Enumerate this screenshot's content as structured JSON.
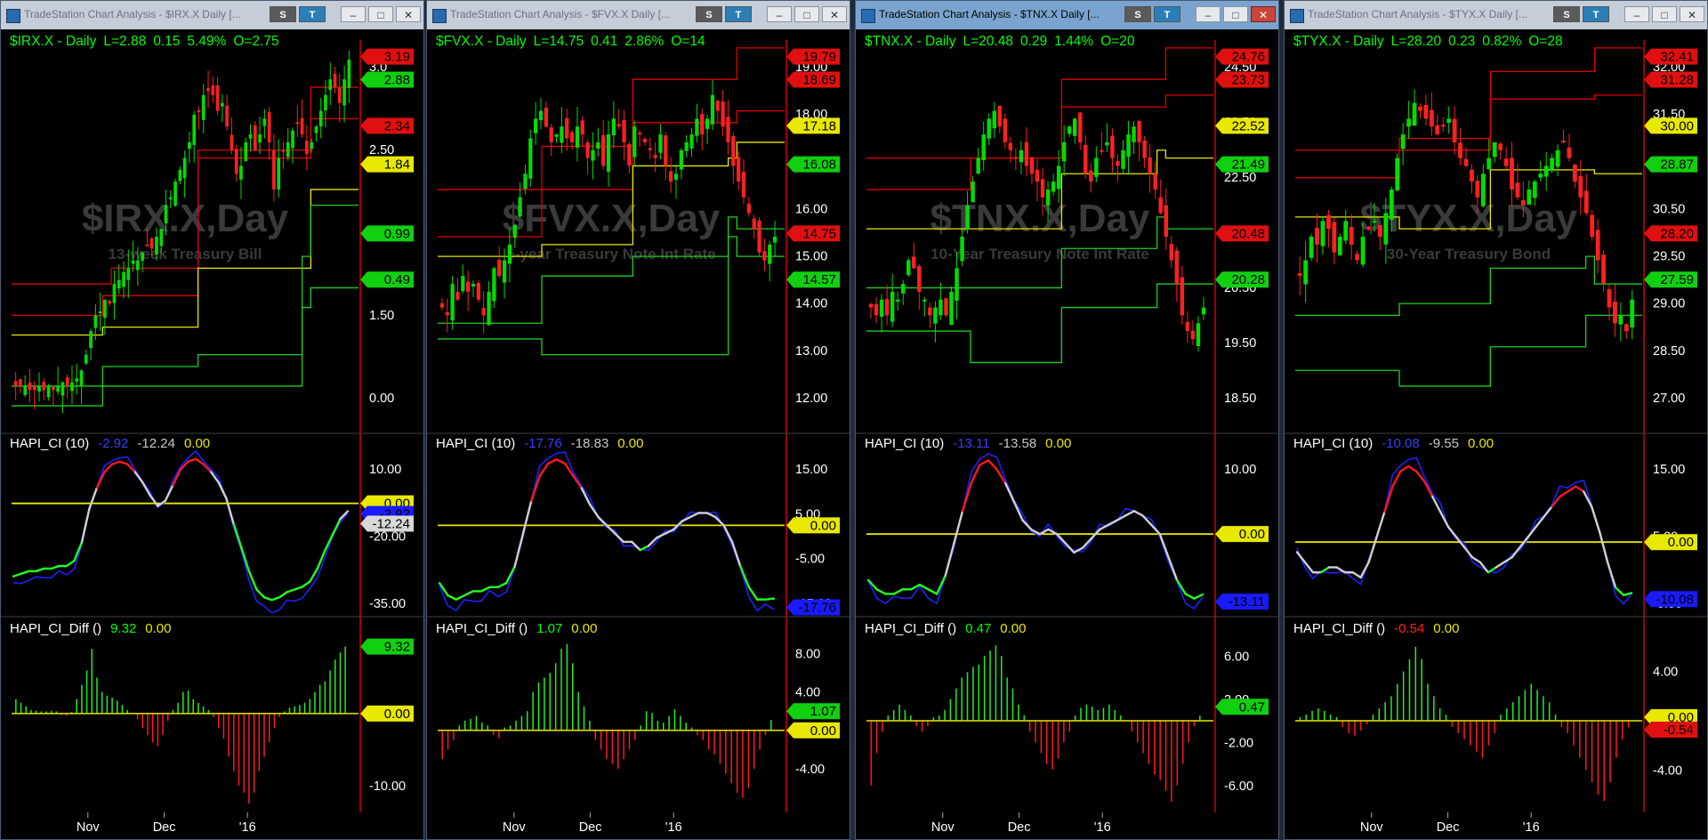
{
  "common": {
    "months": [
      "Nov",
      "Dec",
      "'16"
    ],
    "ci_title": "HAPI_CI (10)",
    "diff_title": "HAPI_CI_Diff ()",
    "btn_s": "S",
    "btn_t": "T",
    "minimize_label": "–",
    "maximize_label": "□",
    "close_label": "✕"
  },
  "colors": {
    "up_candle": "#00dd00",
    "down_candle": "#ff2020",
    "red_line": "#e00000",
    "green_line": "#1ed01e",
    "yellow_line": "#e8e800",
    "ci_blue": "#2020ff",
    "tag_red": "#e01010",
    "tag_green": "#10d010",
    "tag_yellow": "#e8e800",
    "tag_blue": "#1a1aff",
    "tag_gray": "#d8d8d8",
    "axis_red": "#d00000",
    "watermark": "#3a3a3a",
    "title_green": "#00ff00"
  },
  "windows": [
    {
      "window_title": "TradeStation Chart Analysis - $IRX.X Daily [...",
      "active": false,
      "price_header": {
        "symbol": "$IRX.X - Daily",
        "last": "L=2.88",
        "change": "0.15",
        "pct": "5.49%",
        "open": "O=2.75"
      },
      "watermark": "$IRX.X,Day",
      "watermark_sub": "13-week Treasury Bill",
      "price_axis": [
        "3.0",
        "2.50",
        "2.00",
        "1.50",
        "0.00"
      ],
      "price_tags": [
        {
          "value": "3.19",
          "color": "red"
        },
        {
          "value": "2.88",
          "color": "green"
        },
        {
          "value": "2.34",
          "color": "red"
        },
        {
          "value": "1.84",
          "color": "yellow"
        },
        {
          "value": "0.99",
          "color": "green"
        },
        {
          "value": "0.49",
          "color": "green"
        }
      ],
      "ci_values": {
        "v1": "-2.92",
        "v2": "-12.24",
        "v3": "0.00"
      },
      "ci_axis": [
        "10.00",
        "-20.00",
        "-35.00"
      ],
      "ci_tags": [
        {
          "value": "0.00",
          "color": "yellow"
        },
        {
          "value": "-2.92",
          "color": "blue"
        },
        {
          "value": "-12.24",
          "color": "gray"
        }
      ],
      "diff_values": {
        "v1": "9.32",
        "v2": "0.00"
      },
      "diff_axis": [
        "-10.00"
      ],
      "diff_tags": [
        {
          "value": "9.32",
          "color": "green"
        },
        {
          "value": "0.00",
          "color": "yellow"
        }
      ]
    },
    {
      "window_title": "TradeStation Chart Analysis - $FVX.X Daily [...",
      "active": false,
      "price_header": {
        "symbol": "$FVX.X - Daily",
        "last": "L=14.75",
        "change": "0.41",
        "pct": "2.86%",
        "open": "O=14"
      },
      "watermark": "$FVX.X,Day",
      "watermark_sub": "5-year Treasury Note Int Rate",
      "price_axis": [
        "19.00",
        "18.00",
        "17.00",
        "16.00",
        "15.00",
        "14.00",
        "13.00",
        "12.00"
      ],
      "price_tags": [
        {
          "value": "19.79",
          "color": "red"
        },
        {
          "value": "18.69",
          "color": "red"
        },
        {
          "value": "17.18",
          "color": "yellow"
        },
        {
          "value": "16.08",
          "color": "green"
        },
        {
          "value": "14.75",
          "color": "red"
        },
        {
          "value": "14.57",
          "color": "green"
        }
      ],
      "ci_values": {
        "v1": "-17.76",
        "v2": "-18.83",
        "v3": "0.00"
      },
      "ci_axis": [
        "15.00",
        "5.00",
        "-5.00",
        "-15.00"
      ],
      "ci_tags": [
        {
          "value": "0.00",
          "color": "yellow"
        },
        {
          "value": "-17.76",
          "color": "blue"
        }
      ],
      "diff_values": {
        "v1": "1.07",
        "v2": "0.00"
      },
      "diff_axis": [
        "8.00",
        "4.00",
        "-4.00"
      ],
      "diff_tags": [
        {
          "value": "1.07",
          "color": "green"
        },
        {
          "value": "0.00",
          "color": "yellow"
        }
      ]
    },
    {
      "window_title": "TradeStation Chart Analysis - $TNX.X Daily [...",
      "active": true,
      "price_header": {
        "symbol": "$TNX.X - Daily",
        "last": "L=20.48",
        "change": "0.29",
        "pct": "1.44%",
        "open": "O=20"
      },
      "watermark": "$TNX.X,Day",
      "watermark_sub": "10-Year Treasury Note Int Rate",
      "price_axis": [
        "24.50",
        "23.50",
        "22.50",
        "21.50",
        "20.50",
        "19.50",
        "18.50"
      ],
      "price_tags": [
        {
          "value": "24.76",
          "color": "red"
        },
        {
          "value": "23.73",
          "color": "red"
        },
        {
          "value": "22.52",
          "color": "yellow"
        },
        {
          "value": "21.49",
          "color": "green"
        },
        {
          "value": "20.48",
          "color": "red"
        },
        {
          "value": "20.28",
          "color": "green"
        }
      ],
      "ci_values": {
        "v1": "-13.11",
        "v2": "-13.58",
        "v3": "0.00"
      },
      "ci_axis": [
        "10.00",
        "0.00",
        "-10.00"
      ],
      "ci_tags": [
        {
          "value": "0.00",
          "color": "yellow"
        },
        {
          "value": "-13.11",
          "color": "blue"
        }
      ],
      "diff_values": {
        "v1": "0.47",
        "v2": "0.00"
      },
      "diff_axis": [
        "6.00",
        "2.00",
        "-2.00",
        "-6.00"
      ],
      "diff_tags": [
        {
          "value": "0.47",
          "color": "green"
        }
      ]
    },
    {
      "window_title": "TradeStation Chart Analysis - $TYX.X Daily [...",
      "active": false,
      "price_header": {
        "symbol": "$TYX.X - Daily",
        "last": "L=28.20",
        "change": "0.23",
        "pct": "0.82%",
        "open": "O=28"
      },
      "watermark": "$TYX.X,Day",
      "watermark_sub": "30-Year Treasury Bond",
      "price_axis": [
        "32.00",
        "31.50",
        "31.00",
        "30.50",
        "29.50",
        "29.00",
        "28.50",
        "27.00"
      ],
      "price_tags": [
        {
          "value": "32.41",
          "color": "red"
        },
        {
          "value": "31.28",
          "color": "red"
        },
        {
          "value": "30.00",
          "color": "yellow"
        },
        {
          "value": "28.87",
          "color": "green"
        },
        {
          "value": "28.20",
          "color": "red"
        },
        {
          "value": "27.59",
          "color": "green"
        }
      ],
      "ci_values": {
        "v1": "-10.08",
        "v2": "-9.55",
        "v3": "0.00"
      },
      "ci_axis": [
        "15.00",
        "5.00",
        "-5.00"
      ],
      "ci_tags": [
        {
          "value": "0.00",
          "color": "yellow"
        },
        {
          "value": "-10.08",
          "color": "blue"
        }
      ],
      "diff_values": {
        "v1": "-0.54",
        "v2": "0.00"
      },
      "diff_axis": [
        "4.00",
        "-4.00"
      ],
      "diff_tags": [
        {
          "value": "0.00",
          "color": "yellow"
        },
        {
          "value": "-0.54",
          "color": "red"
        }
      ]
    }
  ]
}
